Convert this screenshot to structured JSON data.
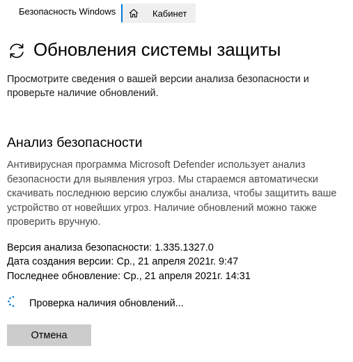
{
  "window": {
    "app_title": "Безопасность Windows",
    "home_tab_label": "Кабинет",
    "accent_color": "#0078d7"
  },
  "header": {
    "title": "Обновления системы защиты",
    "subtitle": "Просмотрите сведения о вашей версии анализа безопасности и проверьте наличие обновлений.",
    "icon": "refresh-icon"
  },
  "section": {
    "title": "Анализ безопасности",
    "description": "Антивирусная программа Microsoft Defender использует анализ безопасности для выявления угроз. Мы стараемся автоматически скачивать последнюю версию службы анализа, чтобы защитить ваше устройство от новейших угроз. Наличие обновлений можно также проверить вручную."
  },
  "info": {
    "version": "Версия анализа безопасности: 1.335.1327.0",
    "created": "Дата создания версии: Ср., 21 апреля 2021г. 9:47",
    "last_update": "Последнее обновление: Ср., 21 апреля 2021г. 14:31"
  },
  "progress": {
    "text": "Проверка наличия обновлений...",
    "icon": "spinner-icon"
  },
  "actions": {
    "cancel_label": "Отмена"
  }
}
